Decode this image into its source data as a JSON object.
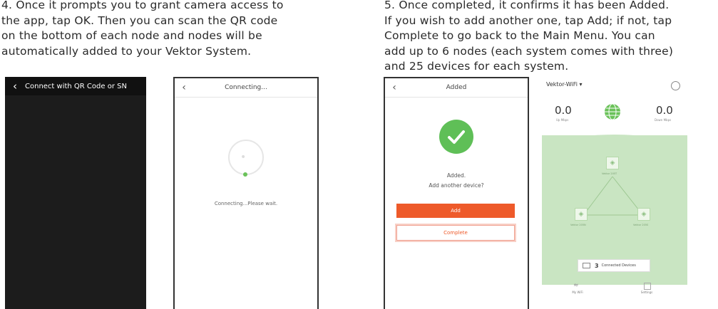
{
  "step4": {
    "lines": [
      "4. Once it prompts you to grant camera access to",
      "the app, tap OK. Then you can scan the QR code",
      "on the bottom of each node and nodes will be",
      "automatically added to your Vektor System."
    ]
  },
  "step5": {
    "lines": [
      "5. Once completed, it confirms it has been Added.",
      "If you wish to add another one, tap Add; if not, tap",
      "Complete to go back to the Main Menu. You can",
      "add up to 6 nodes (each system comes with three)",
      "and 25 devices for each system."
    ]
  },
  "screen_scan": {
    "back_icon": "chevron-left-icon",
    "title": "Connect with QR Code or SN"
  },
  "screen_connecting": {
    "back_icon": "chevron-left-icon",
    "title": "Connecting...",
    "message": "Connecting...Please wait."
  },
  "screen_added": {
    "back_icon": "chevron-left-icon",
    "title": "Added",
    "status": "Added.",
    "question": "Add another device?",
    "add_label": "Add",
    "complete_label": "Complete",
    "accent": "#ee5a2a",
    "success": "#5fbf57"
  },
  "screen_network": {
    "network_name": "Vektor-WiFi ▾",
    "up_value": "0.0",
    "up_label": "Up Mbps",
    "down_value": "0.0",
    "down_label": "Down Mbps",
    "nodes": [
      "Vektor 205T",
      "Vektor 205N",
      "Vektor 205S"
    ],
    "device_count": "3",
    "devices_label": "Connected Devices",
    "nav_wifi": "My WiFi",
    "nav_settings": "Settings"
  }
}
